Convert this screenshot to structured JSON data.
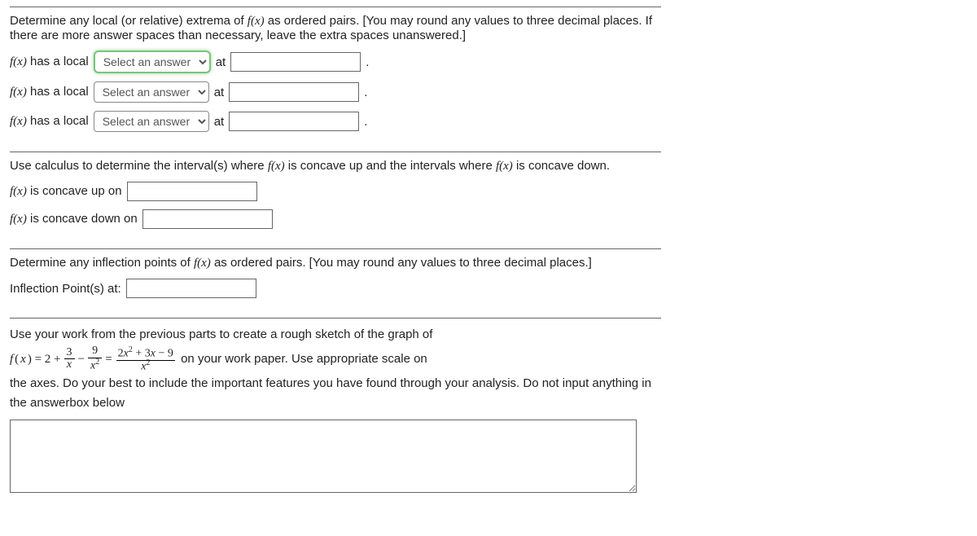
{
  "section1": {
    "prompt": "Determine any local (or relative) extrema of f(x) as ordered pairs. [You may round any values to three decimal places. If there are more answer spaces than necessary, leave the extra spaces unanswered.]",
    "rows": [
      {
        "prefix": "f(x) has a local",
        "select_placeholder": "Select an answer",
        "mid": "at",
        "suffix": "."
      },
      {
        "prefix": "f(x) has a local",
        "select_placeholder": "Select an answer",
        "mid": "at",
        "suffix": "."
      },
      {
        "prefix": "f(x) has a local",
        "select_placeholder": "Select an answer",
        "mid": "at",
        "suffix": "."
      }
    ]
  },
  "section2": {
    "prompt": "Use calculus to determine the interval(s) where f(x) is concave up and the intervals where f(x) is concave down.",
    "rows": [
      {
        "label": "f(x) is concave up on"
      },
      {
        "label": "f(x) is concave down on"
      }
    ]
  },
  "section3": {
    "prompt": "Determine any inflection points of f(x) as ordered pairs. [You may round any values to three decimal places.]",
    "label": "Inflection Point(s) at:"
  },
  "section4": {
    "line1": "Use your work from the previous parts to create a rough sketch of the graph of",
    "eq_lhs": "f(x) = 2 +",
    "eq_f1_num": "3",
    "eq_f1_den": "x",
    "eq_minus": "−",
    "eq_f2_num": "9",
    "eq_f2_den": "x",
    "eq_eq": "=",
    "eq_rhs_num": "2x  + 3x − 9",
    "eq_rhs_den": "x",
    "line2_tail": " on your work paper. Use appropriate scale on",
    "line3": "the axes. Do your best to include the important features you have found through your analysis. Do not input anything in the answerbox below"
  }
}
